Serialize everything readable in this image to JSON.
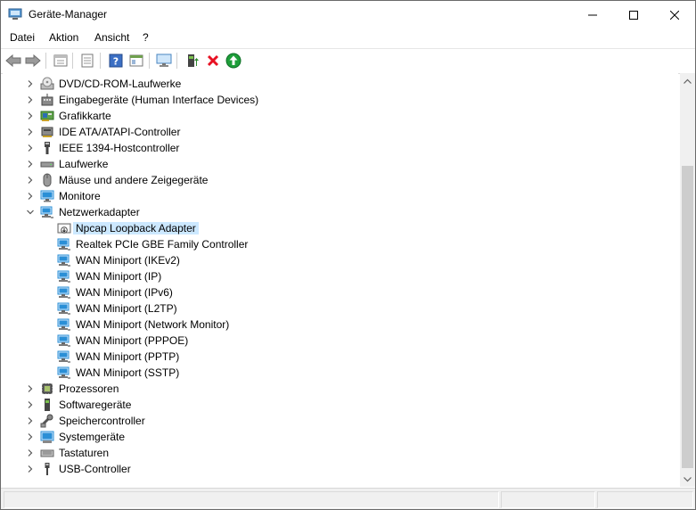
{
  "window": {
    "title": "Geräte-Manager"
  },
  "menu": {
    "items": [
      {
        "label": "Datei"
      },
      {
        "label": "Aktion"
      },
      {
        "label": "Ansicht"
      },
      {
        "label": "?"
      }
    ]
  },
  "toolbar": {
    "buttons": [
      "back-icon",
      "forward-icon",
      "properties-icon",
      "update-icon",
      "help-icon",
      "view-icon",
      "monitor-icon",
      "update-driver-icon",
      "uninstall-icon",
      "enable-device-icon"
    ]
  },
  "tree": {
    "items": [
      {
        "label": "DVD/CD-ROM-Laufwerke",
        "icon": "dvd-drive-icon",
        "expanded": false,
        "level": 0
      },
      {
        "label": "Eingabegeräte (Human Interface Devices)",
        "icon": "hid-icon",
        "expanded": false,
        "level": 0
      },
      {
        "label": "Grafikkarte",
        "icon": "display-adapter-icon",
        "expanded": false,
        "level": 0
      },
      {
        "label": "IDE ATA/ATAPI-Controller",
        "icon": "ide-controller-icon",
        "expanded": false,
        "level": 0
      },
      {
        "label": "IEEE 1394-Hostcontroller",
        "icon": "ieee1394-icon",
        "expanded": false,
        "level": 0
      },
      {
        "label": "Laufwerke",
        "icon": "disk-drive-icon",
        "expanded": false,
        "level": 0
      },
      {
        "label": "Mäuse und andere Zeigegeräte",
        "icon": "mouse-icon",
        "expanded": false,
        "level": 0
      },
      {
        "label": "Monitore",
        "icon": "monitor-icon",
        "expanded": false,
        "level": 0
      },
      {
        "label": "Netzwerkadapter",
        "icon": "network-adapter-icon",
        "expanded": true,
        "level": 0
      },
      {
        "label": "Npcap Loopback Adapter",
        "icon": "disabled-network-adapter-icon",
        "level": 1,
        "selected": true
      },
      {
        "label": "Realtek PCIe GBE Family Controller",
        "icon": "network-adapter-icon",
        "level": 1
      },
      {
        "label": "WAN Miniport (IKEv2)",
        "icon": "network-adapter-icon",
        "level": 1
      },
      {
        "label": "WAN Miniport (IP)",
        "icon": "network-adapter-icon",
        "level": 1
      },
      {
        "label": "WAN Miniport (IPv6)",
        "icon": "network-adapter-icon",
        "level": 1
      },
      {
        "label": "WAN Miniport (L2TP)",
        "icon": "network-adapter-icon",
        "level": 1
      },
      {
        "label": "WAN Miniport (Network Monitor)",
        "icon": "network-adapter-icon",
        "level": 1
      },
      {
        "label": "WAN Miniport (PPPOE)",
        "icon": "network-adapter-icon",
        "level": 1
      },
      {
        "label": "WAN Miniport (PPTP)",
        "icon": "network-adapter-icon",
        "level": 1
      },
      {
        "label": "WAN Miniport (SSTP)",
        "icon": "network-adapter-icon",
        "level": 1
      },
      {
        "label": "Prozessoren",
        "icon": "processor-icon",
        "expanded": false,
        "level": 0
      },
      {
        "label": "Softwaregeräte",
        "icon": "software-device-icon",
        "expanded": false,
        "level": 0
      },
      {
        "label": "Speichercontroller",
        "icon": "storage-controller-icon",
        "expanded": false,
        "level": 0
      },
      {
        "label": "Systemgeräte",
        "icon": "system-device-icon",
        "expanded": false,
        "level": 0
      },
      {
        "label": "Tastaturen",
        "icon": "keyboard-icon",
        "expanded": false,
        "level": 0
      },
      {
        "label": "USB-Controller",
        "icon": "usb-icon",
        "expanded": false,
        "level": 0
      }
    ]
  },
  "colors": {
    "selection": "#cce8ff",
    "network_blue": "#2a8fd6",
    "uninstall_red": "#e81123",
    "enable_green": "#1e9e3a"
  }
}
